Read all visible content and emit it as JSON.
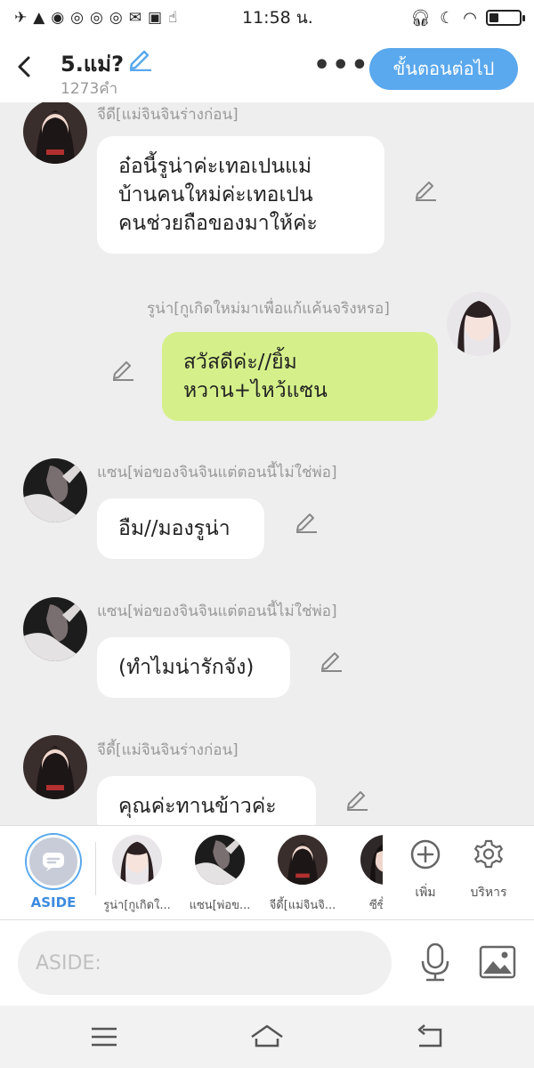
{
  "status_bar": {
    "time": "11:58 น.",
    "left_icons": [
      "airplane-icon",
      "warning-icon",
      "messenger-icon",
      "chrome-icon",
      "chrome-icon",
      "chrome-icon",
      "mail-icon",
      "voicemail-icon",
      "hand-icon"
    ],
    "right_icons": [
      "headphones-icon",
      "moon-icon",
      "wifi-icon",
      "battery-icon"
    ],
    "battery_level": 0.3
  },
  "header": {
    "title": "5.แม่?",
    "word_count": "1273คำ",
    "next_button": "ขั้นตอนต่อไป",
    "accent_color": "#5aa8ee"
  },
  "messages": [
    {
      "side": "left",
      "name": "จีดี[แม่จินจินร่างก่อน]",
      "text": "อ๋อนี้รูน่าค่ะเทอเปนแม่\nบ้านคนใหม่ค่ะเทอเปน\nคนช่วยถือของมาให้ค่ะ"
    },
    {
      "side": "right",
      "name": "รูน่า[กูเกิดใหม่มาเพื่อแก้แค้นจริงหรอ]",
      "text": "สวัสดีค่ะ//ยิ้ม\nหวาน+ไหว้แซน",
      "bubble_color": "#d5f08a"
    },
    {
      "side": "left",
      "name": "แซน[พ่อของจินจินแต่ตอนนี้ไม่ใช่พ่อ]",
      "text": "อืม//มองรูน่า"
    },
    {
      "side": "left",
      "name": "แซน[พ่อของจินจินแต่ตอนนี้ไม่ใช่พ่อ]",
      "text": "(ทำไมน่ารักจัง)"
    },
    {
      "side": "left",
      "name": "จีดี้[แม่จินจินร่างก่อน]",
      "text": "คุณค่ะทานข้าวค่ะ"
    }
  ],
  "character_bar": {
    "aside_label": "ASIDE",
    "characters": [
      {
        "label": "รูน่า[กูเกิดใ..."
      },
      {
        "label": "แซน[พ่อข..."
      },
      {
        "label": "จีดี้[แม่จินจิ..."
      },
      {
        "label": "ซีซี้[เข"
      }
    ],
    "add_label": "เพิ่ม",
    "manage_label": "บริหาร"
  },
  "input_bar": {
    "placeholder": "ASIDE:"
  }
}
